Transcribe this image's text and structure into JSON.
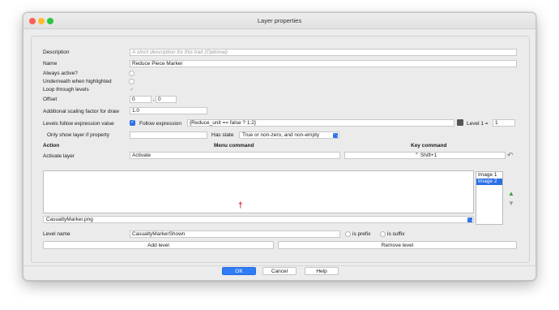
{
  "window": {
    "title": "Layer properties"
  },
  "form": {
    "description": {
      "label": "Description",
      "placeholder": "A short description for this trait (Optional)"
    },
    "name": {
      "label": "Name",
      "value": "Reduce Piece Marker"
    },
    "always_active": {
      "label": "Always active?"
    },
    "underneath": {
      "label": "Underneath when highlighted"
    },
    "loop": {
      "label": "Loop through levels",
      "mark": "✓"
    },
    "offset": {
      "label": "Offset",
      "x": "0",
      "sep": ",",
      "y": "0"
    },
    "scaling": {
      "label": "Additional scaling factor for draw",
      "value": "1.0"
    },
    "follow": {
      "label": "Levels follow expression value",
      "check_mark": "✓",
      "checkbox_label": "Follow expression",
      "expression": "{Reduce_unit == false ? 1:2}",
      "level1_label": "Level 1 =",
      "level1_value": "1"
    },
    "show_if": {
      "label": "Only show layer if property",
      "property": "",
      "has_state_label": "Has state",
      "state_option": "True or non-zero, and non-empty",
      "arrow": "⌃⌄"
    },
    "headers": {
      "action": "Action",
      "menu": "Menu command",
      "key": "Key command"
    },
    "activate": {
      "label": "Activate layer",
      "menu": "Activate",
      "key_prefix": "⌃",
      "key": "Shift+1",
      "undo": "↶"
    },
    "image": {
      "marker": "†",
      "file": "CasualtyMarker.png",
      "arrow": "⌃⌄",
      "list": [
        "Image 1",
        "Image 2"
      ],
      "selected_index": 1,
      "up_icon": "▲",
      "down_icon": "▼"
    },
    "level_name": {
      "label": "Level name",
      "value": "CasualtyMarkerShown",
      "prefix_label": "is prefix",
      "suffix_label": "is suffix"
    },
    "add_level": "Add level",
    "remove_level": "Remove level"
  },
  "footer": {
    "ok": "OK",
    "cancel": "Cancel",
    "help": "Help"
  },
  "colors": {
    "accent": "#2b6fe6",
    "close": "#fe5f57",
    "minimize": "#febc2e",
    "zoom": "#28c840",
    "marker": "#d21c1c"
  }
}
